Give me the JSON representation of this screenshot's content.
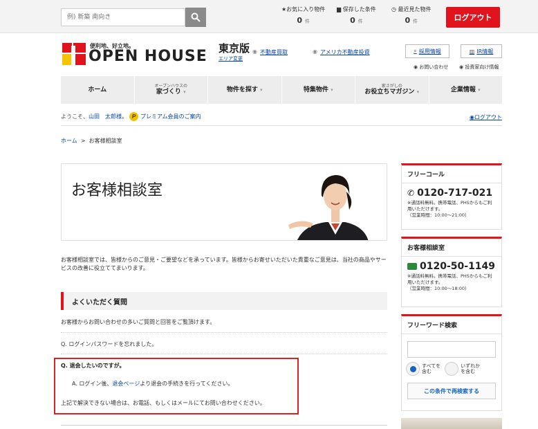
{
  "topbar": {
    "search_placeholder": "例) 新築 南向き",
    "favorites": {
      "label": "お気に入り物件",
      "count": "0",
      "unit": "件"
    },
    "saved": {
      "label": "保存した条件",
      "count": "0",
      "unit": "件"
    },
    "recent": {
      "label": "最近見た物件",
      "count": "0",
      "unit": "件"
    },
    "logout_label": "ログアウト"
  },
  "header": {
    "logo_tag": "便利地、好立地。",
    "logo_text": "OPEN HOUSE",
    "edition": "東京版",
    "edition_link": "エリア変更",
    "links": [
      "不動産買取",
      "アメリカ不動産投資"
    ],
    "recruit_label": "採用情報",
    "ir_label": "IR情報",
    "inquiry_label": "お問い合わせ",
    "investor_label": "投資家向け情報"
  },
  "gnav": [
    {
      "sub": "",
      "label": "ホーム",
      "arrow": ""
    },
    {
      "sub": "オープンハウスの",
      "label": "家づくり",
      "arrow": "▾"
    },
    {
      "sub": "",
      "label": "物件を探す",
      "arrow": "▾"
    },
    {
      "sub": "",
      "label": "特集物件",
      "arrow": "▾"
    },
    {
      "sub": "家さがしの",
      "label": "お役立ちマガジン",
      "arrow": "▾"
    },
    {
      "sub": "",
      "label": "企業情報",
      "arrow": "▾"
    }
  ],
  "welcome": {
    "prefix": "ようこそ、",
    "user": "山田　太郎様。",
    "premium": "プレミアム会員のご案内",
    "logout": "ログアウト"
  },
  "breadcrumb": {
    "home": "ホーム",
    "sep": ">",
    "current": "お客様相談室"
  },
  "main": {
    "title": "お客様相談室",
    "intro": "お客様相談室では、皆様からのご意見・ご要望などを承っています。皆様からお寄せいただいた貴重なご意見は、当社の商品やサービスの改善に役立ててまいります。",
    "faq_title": "よくいただく質問",
    "faq_desc": "お客様からお問い合わせの多いご質問と回答をご覧頂けます。",
    "q1": "Q. ログインパスワードを忘れました。",
    "q2": "Q. 退会したいのですが。",
    "a2_prefix": "A. ログイン後、",
    "a2_link": "退会ページ",
    "a2_suffix": "より退会の手続きを行ってください。",
    "a3": "上記で解決できない場合は、お電話、もしくはメールにてお問い合わせください。"
  },
  "sidebar": {
    "free_call": {
      "title": "フリーコール",
      "number": "0120-717-021",
      "note1": "※通話料無料。携帯電話、PHSからもご利用いただけます。",
      "note2": "（営業時間：10:00〜21:00）"
    },
    "consult": {
      "title": "お客様相談室",
      "number": "0120-50-1149",
      "note1": "※通話料無料。携帯電話、PHSからもご利用いただけます。",
      "note2": "（営業時間：10:00〜18:00）"
    },
    "freeword": {
      "title": "フリーワード検索",
      "radio_all_1": "すべてを",
      "radio_all_2": "含む",
      "radio_any_1": "いずれか",
      "radio_any_2": "を含む",
      "button": "この条件で再検索する"
    }
  },
  "colors": {
    "accent": "#e1131d",
    "link": "#0645ad"
  }
}
